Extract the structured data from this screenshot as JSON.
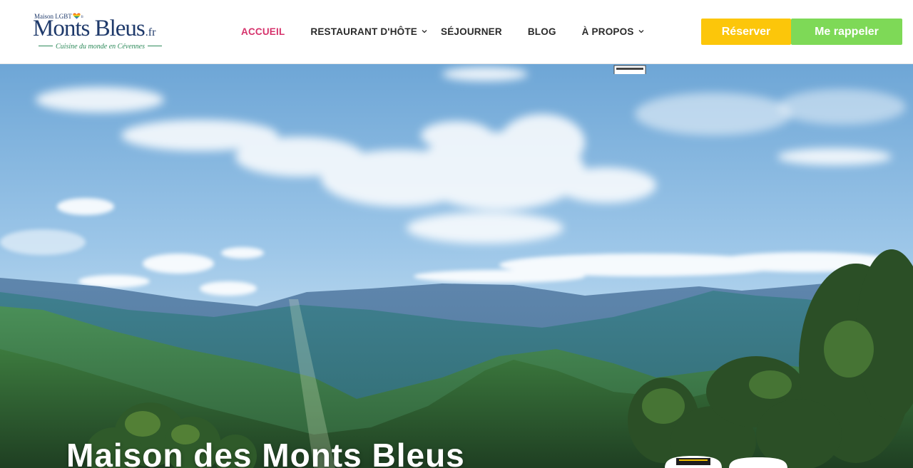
{
  "logo": {
    "top_text": "Maison LGBT",
    "heart_suffix": "fr",
    "main_text": "Monts Bleus",
    "tld": ".fr",
    "tagline": "Cuisine du monde en Cévennes"
  },
  "nav": {
    "items": [
      {
        "label": "ACCUEIL",
        "active": true,
        "has_dropdown": false
      },
      {
        "label": "RESTAURANT D'HÔTE",
        "active": false,
        "has_dropdown": true
      },
      {
        "label": "SÉJOURNER",
        "active": false,
        "has_dropdown": false
      },
      {
        "label": "BLOG",
        "active": false,
        "has_dropdown": false
      },
      {
        "label": "À PROPOS",
        "active": false,
        "has_dropdown": true
      }
    ]
  },
  "actions": {
    "reserver_label": "Réserver",
    "rappeler_label": "Me rappeler"
  },
  "hero": {
    "title": "Maison des Monts Bleus"
  },
  "colors": {
    "brand_navy": "#1f3a6b",
    "nav_active": "#d6336c",
    "reserver_bg": "#fcc60a",
    "rappeler_bg": "#7ed957",
    "tagline_green": "#2d8a5a"
  },
  "icons": {
    "dropdown": "chevron-down-icon",
    "logo_heart": "rainbow-heart-icon"
  }
}
